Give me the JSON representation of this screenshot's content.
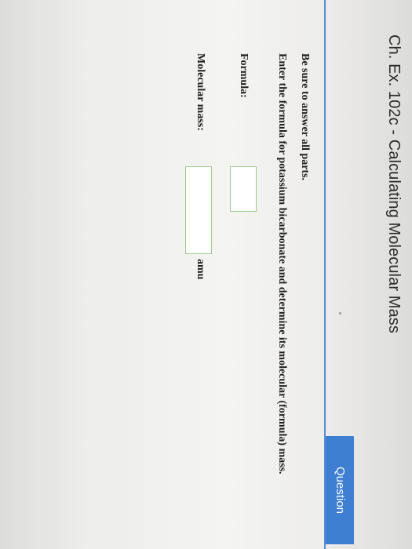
{
  "page": {
    "title": "Ch. Ex. 102c - Calculating Molecular Mass"
  },
  "tab": {
    "label": "Question"
  },
  "question": {
    "instruction": "Be sure to answer all parts.",
    "prompt": "Enter the formula for potassium bicarbonate and determine its molecular (formula) mass."
  },
  "fields": {
    "formula": {
      "label": "Formula:",
      "value": ""
    },
    "molecular_mass": {
      "label": "Molecular mass:",
      "value": "",
      "unit": "amu"
    }
  },
  "colors": {
    "accent": "#3e7fd1",
    "input_border": "#9ccf8c"
  }
}
